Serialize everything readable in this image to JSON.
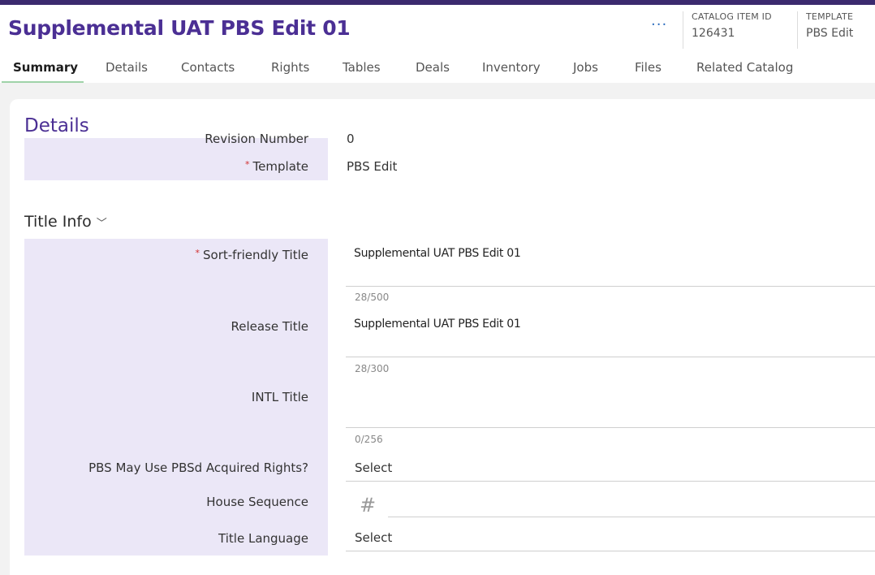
{
  "header": {
    "title": "Supplemental UAT PBS Edit 01",
    "more_icon": "more-horizontal-icon",
    "catalog_item_id_label": "CATALOG ITEM ID",
    "catalog_item_id": "126431",
    "template_label": "TEMPLATE",
    "template_value": "PBS Edit"
  },
  "tabs": [
    "Summary",
    "Details",
    "Contacts",
    "Rights",
    "Tables",
    "Deals",
    "Inventory",
    "Jobs",
    "Files",
    "Related Catalog"
  ],
  "details": {
    "title": "Details",
    "revision_label": "Revision Number",
    "revision_value": "0",
    "template_label": "Template",
    "template_value": "PBS Edit"
  },
  "title_info": {
    "title": "Title Info",
    "chevron": "chevron-down-icon",
    "sort_title_label": "Sort-friendly Title",
    "sort_title_value": "Supplemental UAT PBS Edit 01",
    "sort_title_counter": "28/500",
    "release_title_label": "Release Title",
    "release_title_value": "Supplemental UAT PBS Edit 01",
    "release_title_counter": "28/300",
    "intl_title_label": "INTL Title",
    "intl_title_value": "",
    "intl_title_counter": "0/256",
    "acquired_rights_label": "PBS May Use PBSd Acquired Rights?",
    "acquired_rights_value": "Select",
    "house_sequence_label": "House Sequence",
    "house_sequence_value": "",
    "title_language_label": "Title Language",
    "title_language_value": "Select"
  },
  "colors": {
    "brand": "#4b2f94",
    "topbar": "#3b2a6e",
    "label_panel": "#ebe7f7",
    "required": "#d23030",
    "active_tab_underline": "#9fd3a9"
  }
}
